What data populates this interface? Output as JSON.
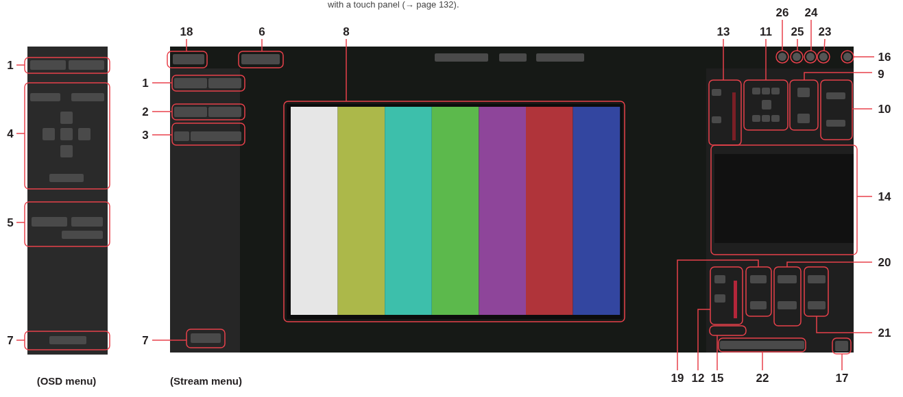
{
  "page_note": "with a touch panel  (→ page 132).",
  "figures": [
    {
      "caption": "(OSD menu)",
      "callouts": [
        "1",
        "4",
        "5",
        "7"
      ]
    },
    {
      "caption": "(Stream menu)",
      "callouts": [
        "18",
        "6",
        "8",
        "1",
        "2",
        "3",
        "7",
        "13",
        "11",
        "26",
        "25",
        "24",
        "23",
        "16",
        "9",
        "10",
        "14",
        "20",
        "21",
        "19",
        "12",
        "15",
        "22",
        "17"
      ]
    }
  ]
}
